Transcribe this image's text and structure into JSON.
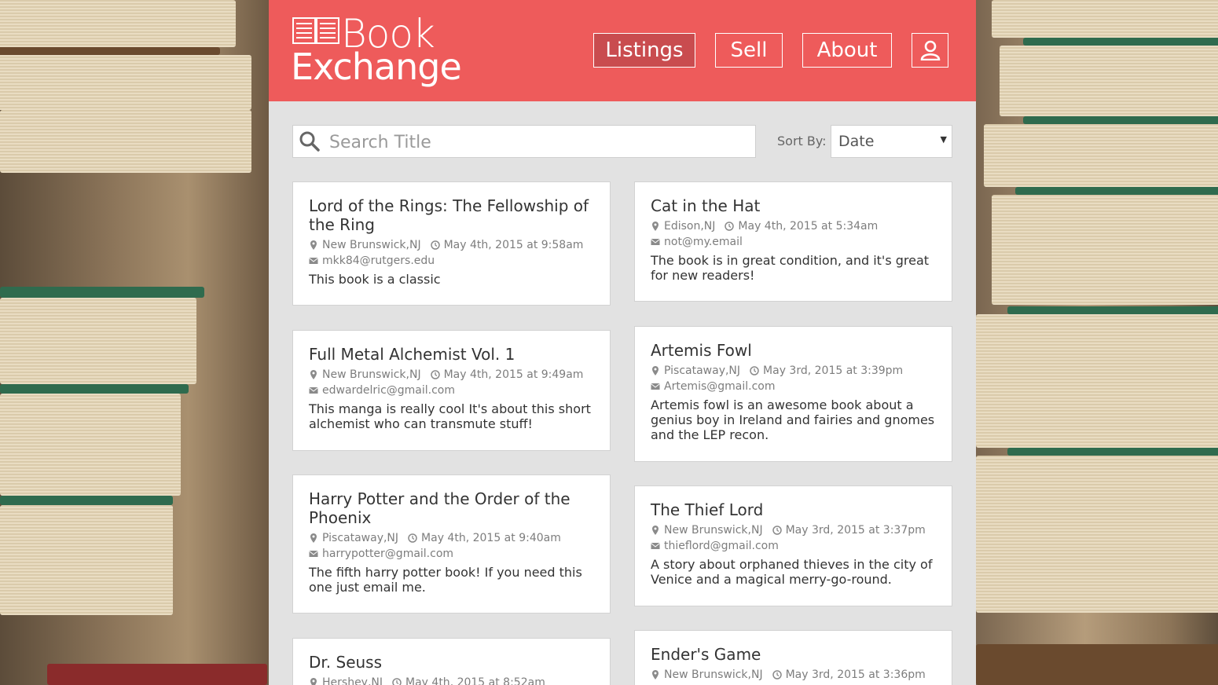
{
  "app": {
    "logo_line1": "Book",
    "logo_line2": "Exchange"
  },
  "nav": {
    "listings": "Listings",
    "sell": "Sell",
    "about": "About",
    "user_icon": "user-icon"
  },
  "toolbar": {
    "search_placeholder": "Search Title",
    "sort_label": "Sort By:",
    "sort_value": "Date"
  },
  "colors": {
    "header": "#ee5b5b",
    "active_nav": "#c94c4f",
    "panel": "#e2e2e2"
  },
  "listings": [
    {
      "title": "Lord of the Rings: The Fellowship of the Ring",
      "location": "New Brunswick,NJ",
      "date": "May 4th, 2015 at 9:58am",
      "email": "mkk84@rutgers.edu",
      "description": "This book is a classic"
    },
    {
      "title": "Cat in the Hat",
      "location": "Edison,NJ",
      "date": "May 4th, 2015 at 5:34am",
      "email": "not@my.email",
      "description": "The book is in great condition, and it's great for new readers!"
    },
    {
      "title": "Full Metal Alchemist Vol. 1",
      "location": "New Brunswick,NJ",
      "date": "May 4th, 2015 at 9:49am",
      "email": "edwardelric@gmail.com",
      "description": "This manga is really cool It's about this short alchemist who can transmute stuff!"
    },
    {
      "title": "Artemis Fowl",
      "location": "Piscataway,NJ",
      "date": "May 3rd, 2015 at 3:39pm",
      "email": "Artemis@gmail.com",
      "description": "Artemis fowl is an awesome book about a genius boy in Ireland and fairies and gnomes and the LEP recon."
    },
    {
      "title": "Harry Potter and the Order of the Phoenix",
      "location": "Piscataway,NJ",
      "date": "May 4th, 2015 at 9:40am",
      "email": "harrypotter@gmail.com",
      "description": "The fifth harry potter book! If you need this one just email me."
    },
    {
      "title": "The Thief Lord",
      "location": "New Brunswick,NJ",
      "date": "May 3rd, 2015 at 3:37pm",
      "email": "thieflord@gmail.com",
      "description": "A story about orphaned thieves in the city of Venice and a magical merry-go-round."
    },
    {
      "title": "Dr. Seuss",
      "location": "Hershey,NJ",
      "date": "May 4th, 2015 at 8:52am",
      "email": "",
      "description": ""
    },
    {
      "title": "Ender's Game",
      "location": "New Brunswick,NJ",
      "date": "May 3rd, 2015 at 3:36pm",
      "email": "",
      "description": ""
    }
  ]
}
